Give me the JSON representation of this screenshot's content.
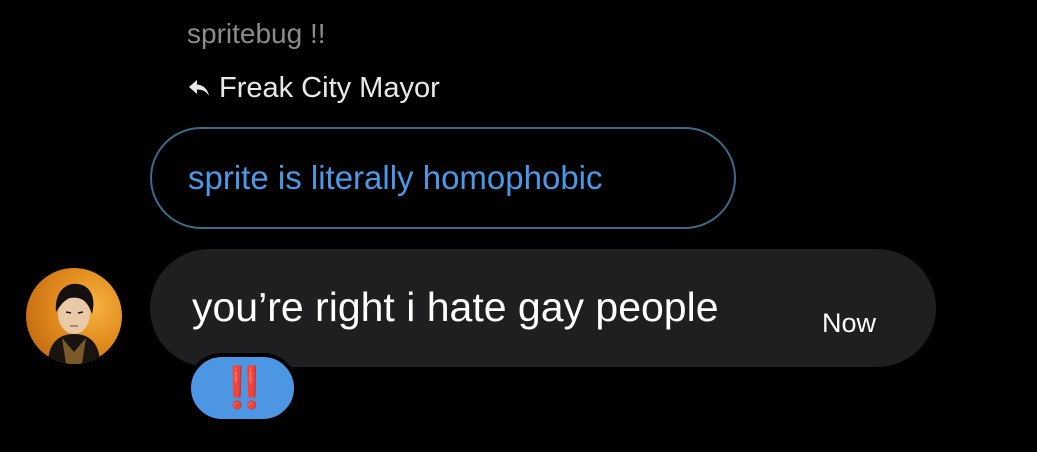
{
  "conversation": {
    "sender_name": "spritebug !!",
    "reply_to": {
      "icon": "reply-arrow-icon",
      "label": "Freak City Mayor"
    },
    "quoted_message": {
      "text": "sprite is literally homophobic",
      "color": "#4a99e9"
    },
    "message": {
      "text": "you’re right i hate gay people",
      "timestamp": "Now",
      "bubble_color": "#1f1f21"
    },
    "reaction": {
      "emoji": "‼️",
      "background": "#4d96e4"
    }
  }
}
